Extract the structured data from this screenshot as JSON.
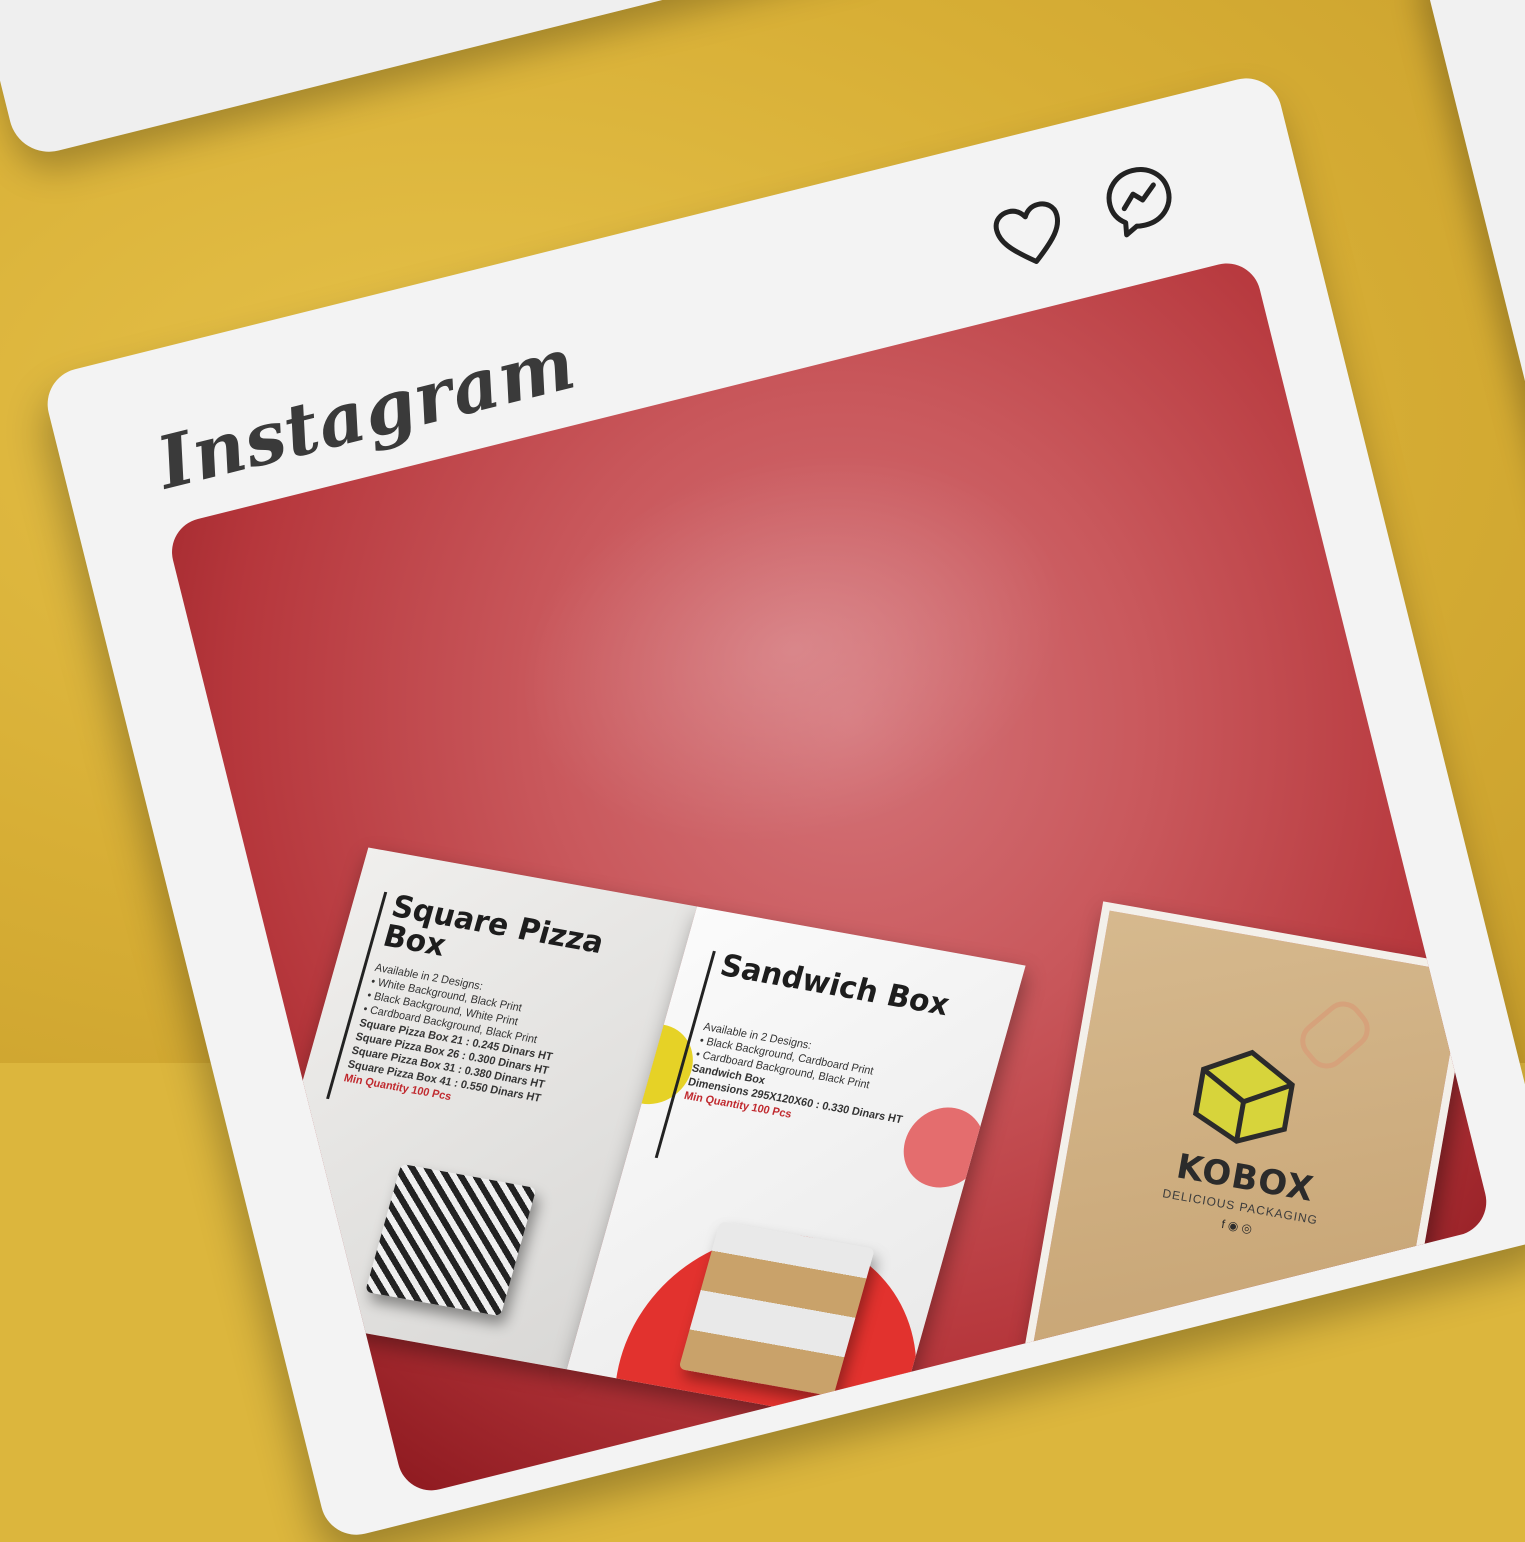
{
  "app": {
    "brand": "Instagram"
  },
  "colors": {
    "background": "#dcb63d",
    "post_red": "#c9585c",
    "like_heart_top": "#e02a2f"
  },
  "icons": {
    "top_like": "heart-filled-icon",
    "top_comment": "comment-icon",
    "like": "heart-outline-icon",
    "share": "messenger-icon"
  },
  "brochure": {
    "left": {
      "title": "Square Pizza Box",
      "intro": "Available in 2 Designs:",
      "designs": [
        "• White Background, Black Print",
        "• Black Background, White Print",
        "• Cardboard Background, Black Print"
      ],
      "prices": [
        "Square Pizza Box 21 : 0.245 Dinars HT",
        "Square Pizza Box 26 : 0.300 Dinars HT",
        "Square Pizza Box 31 : 0.380 Dinars HT",
        "Square Pizza Box 41 : 0.550 Dinars HT"
      ],
      "min_qty": "Min Quantity 100 Pcs"
    },
    "right": {
      "title": "Sandwich Box",
      "intro": "Available in 2 Designs:",
      "designs": [
        "• Black Background, Cardboard Print",
        "• Cardboard Background, Black Print"
      ],
      "item": "Sandwich Box",
      "dims": "Dimensions 295X120X60 : 0.330 Dinars HT",
      "min_qty": "Min Quantity 100 Pcs"
    }
  },
  "card": {
    "name": "KOBOX",
    "tagline": "DELICIOUS PACKAGING",
    "socials": "f ◉ ◎"
  }
}
